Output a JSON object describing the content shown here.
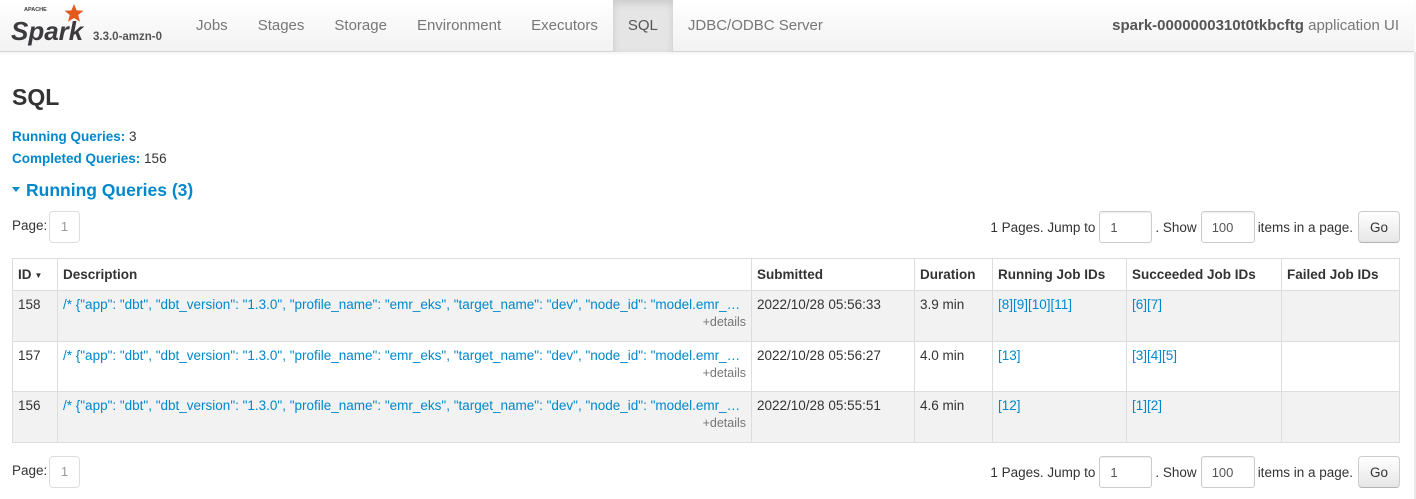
{
  "brand": {
    "logo_top": "APACHE",
    "logo_text": "Spark",
    "version": "3.3.0-amzn-0"
  },
  "nav": {
    "tabs": [
      {
        "label": "Jobs",
        "active": false
      },
      {
        "label": "Stages",
        "active": false
      },
      {
        "label": "Storage",
        "active": false
      },
      {
        "label": "Environment",
        "active": false
      },
      {
        "label": "Executors",
        "active": false
      },
      {
        "label": "SQL",
        "active": true
      },
      {
        "label": "JDBC/ODBC Server",
        "active": false
      }
    ],
    "app_id": "spark-0000000310t0tkbcftg",
    "app_suffix": " application UI"
  },
  "page": {
    "title": "SQL",
    "running_label": "Running Queries:",
    "running_value": "3",
    "completed_label": "Completed Queries:",
    "completed_value": "156",
    "section_title": "Running Queries (3)"
  },
  "pager": {
    "page_label": "Page:",
    "current_page": "1",
    "pages_text": "1 Pages. Jump to",
    "jump_value": "1",
    "show_text": ". Show",
    "page_size": "100",
    "items_text": "items in a page.",
    "go_label": "Go"
  },
  "table": {
    "headers": [
      "ID",
      "Description",
      "Submitted",
      "Duration",
      "Running Job IDs",
      "Succeeded Job IDs",
      "Failed Job IDs"
    ],
    "sort_arrow": "▼",
    "details_label": "+details",
    "rows": [
      {
        "id": "158",
        "description": "/* {\"app\": \"dbt\", \"dbt_version\": \"1.3.0\", \"profile_name\": \"emr_eks\", \"target_name\": \"dev\", \"node_id\": \"model.emr_eks.my_model\"} */",
        "submitted": "2022/10/28 05:56:33",
        "duration": "3.9 min",
        "running": "[8][9][10][11]",
        "succeeded": "[6][7]",
        "failed": ""
      },
      {
        "id": "157",
        "description": "/* {\"app\": \"dbt\", \"dbt_version\": \"1.3.0\", \"profile_name\": \"emr_eks\", \"target_name\": \"dev\", \"node_id\": \"model.emr_eks.my_model\"} */",
        "submitted": "2022/10/28 05:56:27",
        "duration": "4.0 min",
        "running": "[13]",
        "succeeded": "[3][4][5]",
        "failed": ""
      },
      {
        "id": "156",
        "description": "/* {\"app\": \"dbt\", \"dbt_version\": \"1.3.0\", \"profile_name\": \"emr_eks\", \"target_name\": \"dev\", \"node_id\": \"model.emr_eks.my_model\"} */",
        "submitted": "2022/10/28 05:55:51",
        "duration": "4.6 min",
        "running": "[12]",
        "succeeded": "[1][2]",
        "failed": ""
      }
    ]
  },
  "colors": {
    "link": "#0088cc",
    "logo_orange": "#e25a1c",
    "logo_gray": "#3c3a3e"
  }
}
